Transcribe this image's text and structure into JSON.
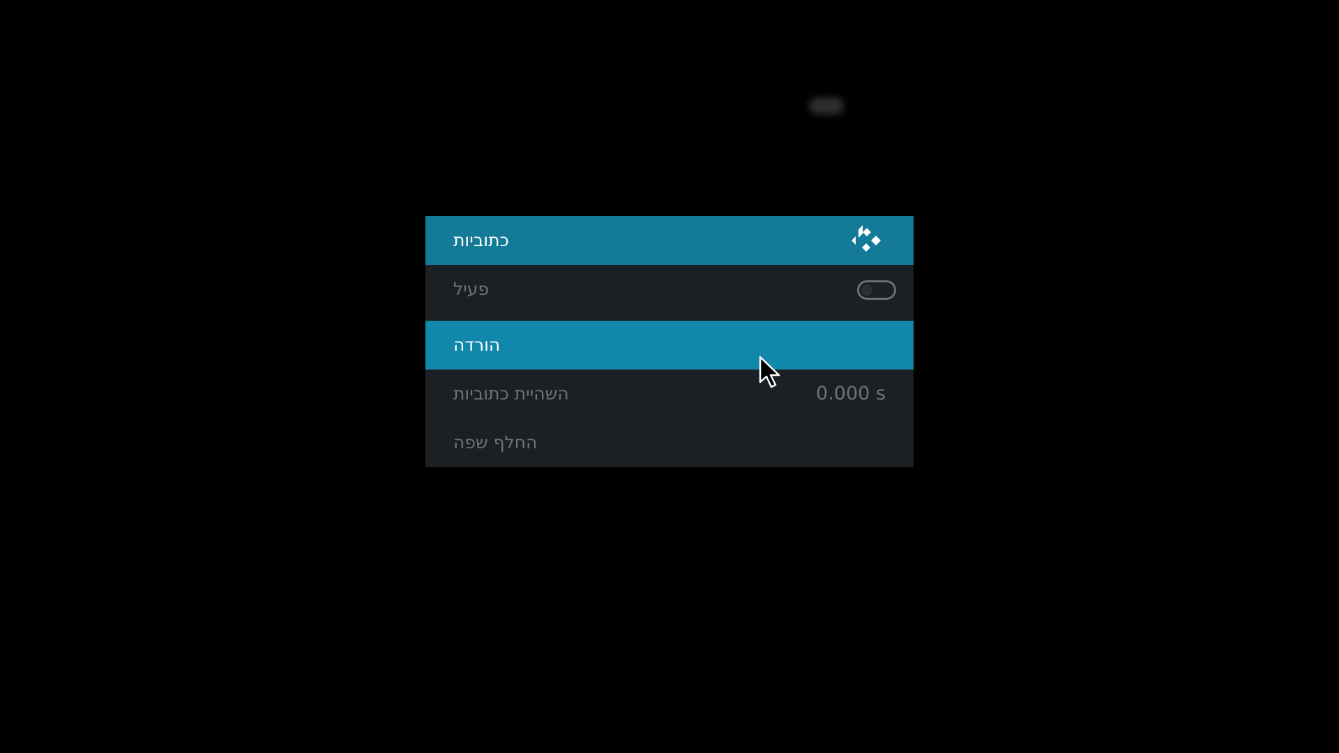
{
  "dialog": {
    "title": "כתוביות",
    "logo_icon": "kodi-logo-icon",
    "items": [
      {
        "label": "פעיל",
        "control": "toggle",
        "toggle_on": false
      },
      {
        "label": "הורדה",
        "selected": true
      },
      {
        "label": "השהיית כתוביות",
        "value": "0.000 s"
      },
      {
        "label": "החלף שפה"
      }
    ]
  },
  "colors": {
    "background": "#000000",
    "header": "#137a98",
    "selected_row": "#1087ab",
    "panel": "#1b2025",
    "dim_text": "#6d7378",
    "text": "#ffffff"
  },
  "cursor_icon": "mouse-pointer-icon"
}
